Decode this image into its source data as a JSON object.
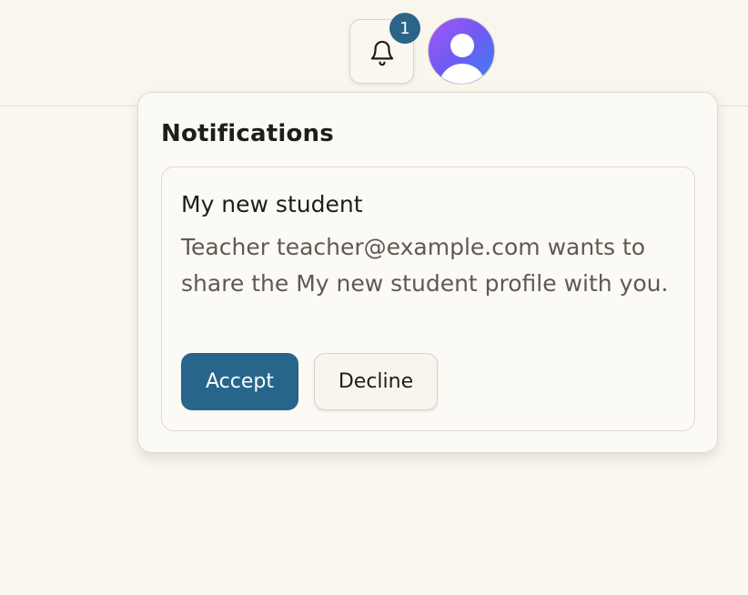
{
  "header": {
    "notification_count": "1",
    "bell_icon": "bell-icon",
    "avatar_icon": "user-avatar-icon"
  },
  "notifications_panel": {
    "title": "Notifications",
    "items": [
      {
        "title": "My new student",
        "message": "Teacher teacher@example.com wants to share the My new student profile with you.",
        "accept_label": "Accept",
        "decline_label": "Decline"
      }
    ]
  },
  "colors": {
    "background": "#faf7f0",
    "accent": "#27658a",
    "badge": "#2a6589",
    "avatar_gradient": [
      "#a855f7",
      "#3b82f6"
    ]
  }
}
